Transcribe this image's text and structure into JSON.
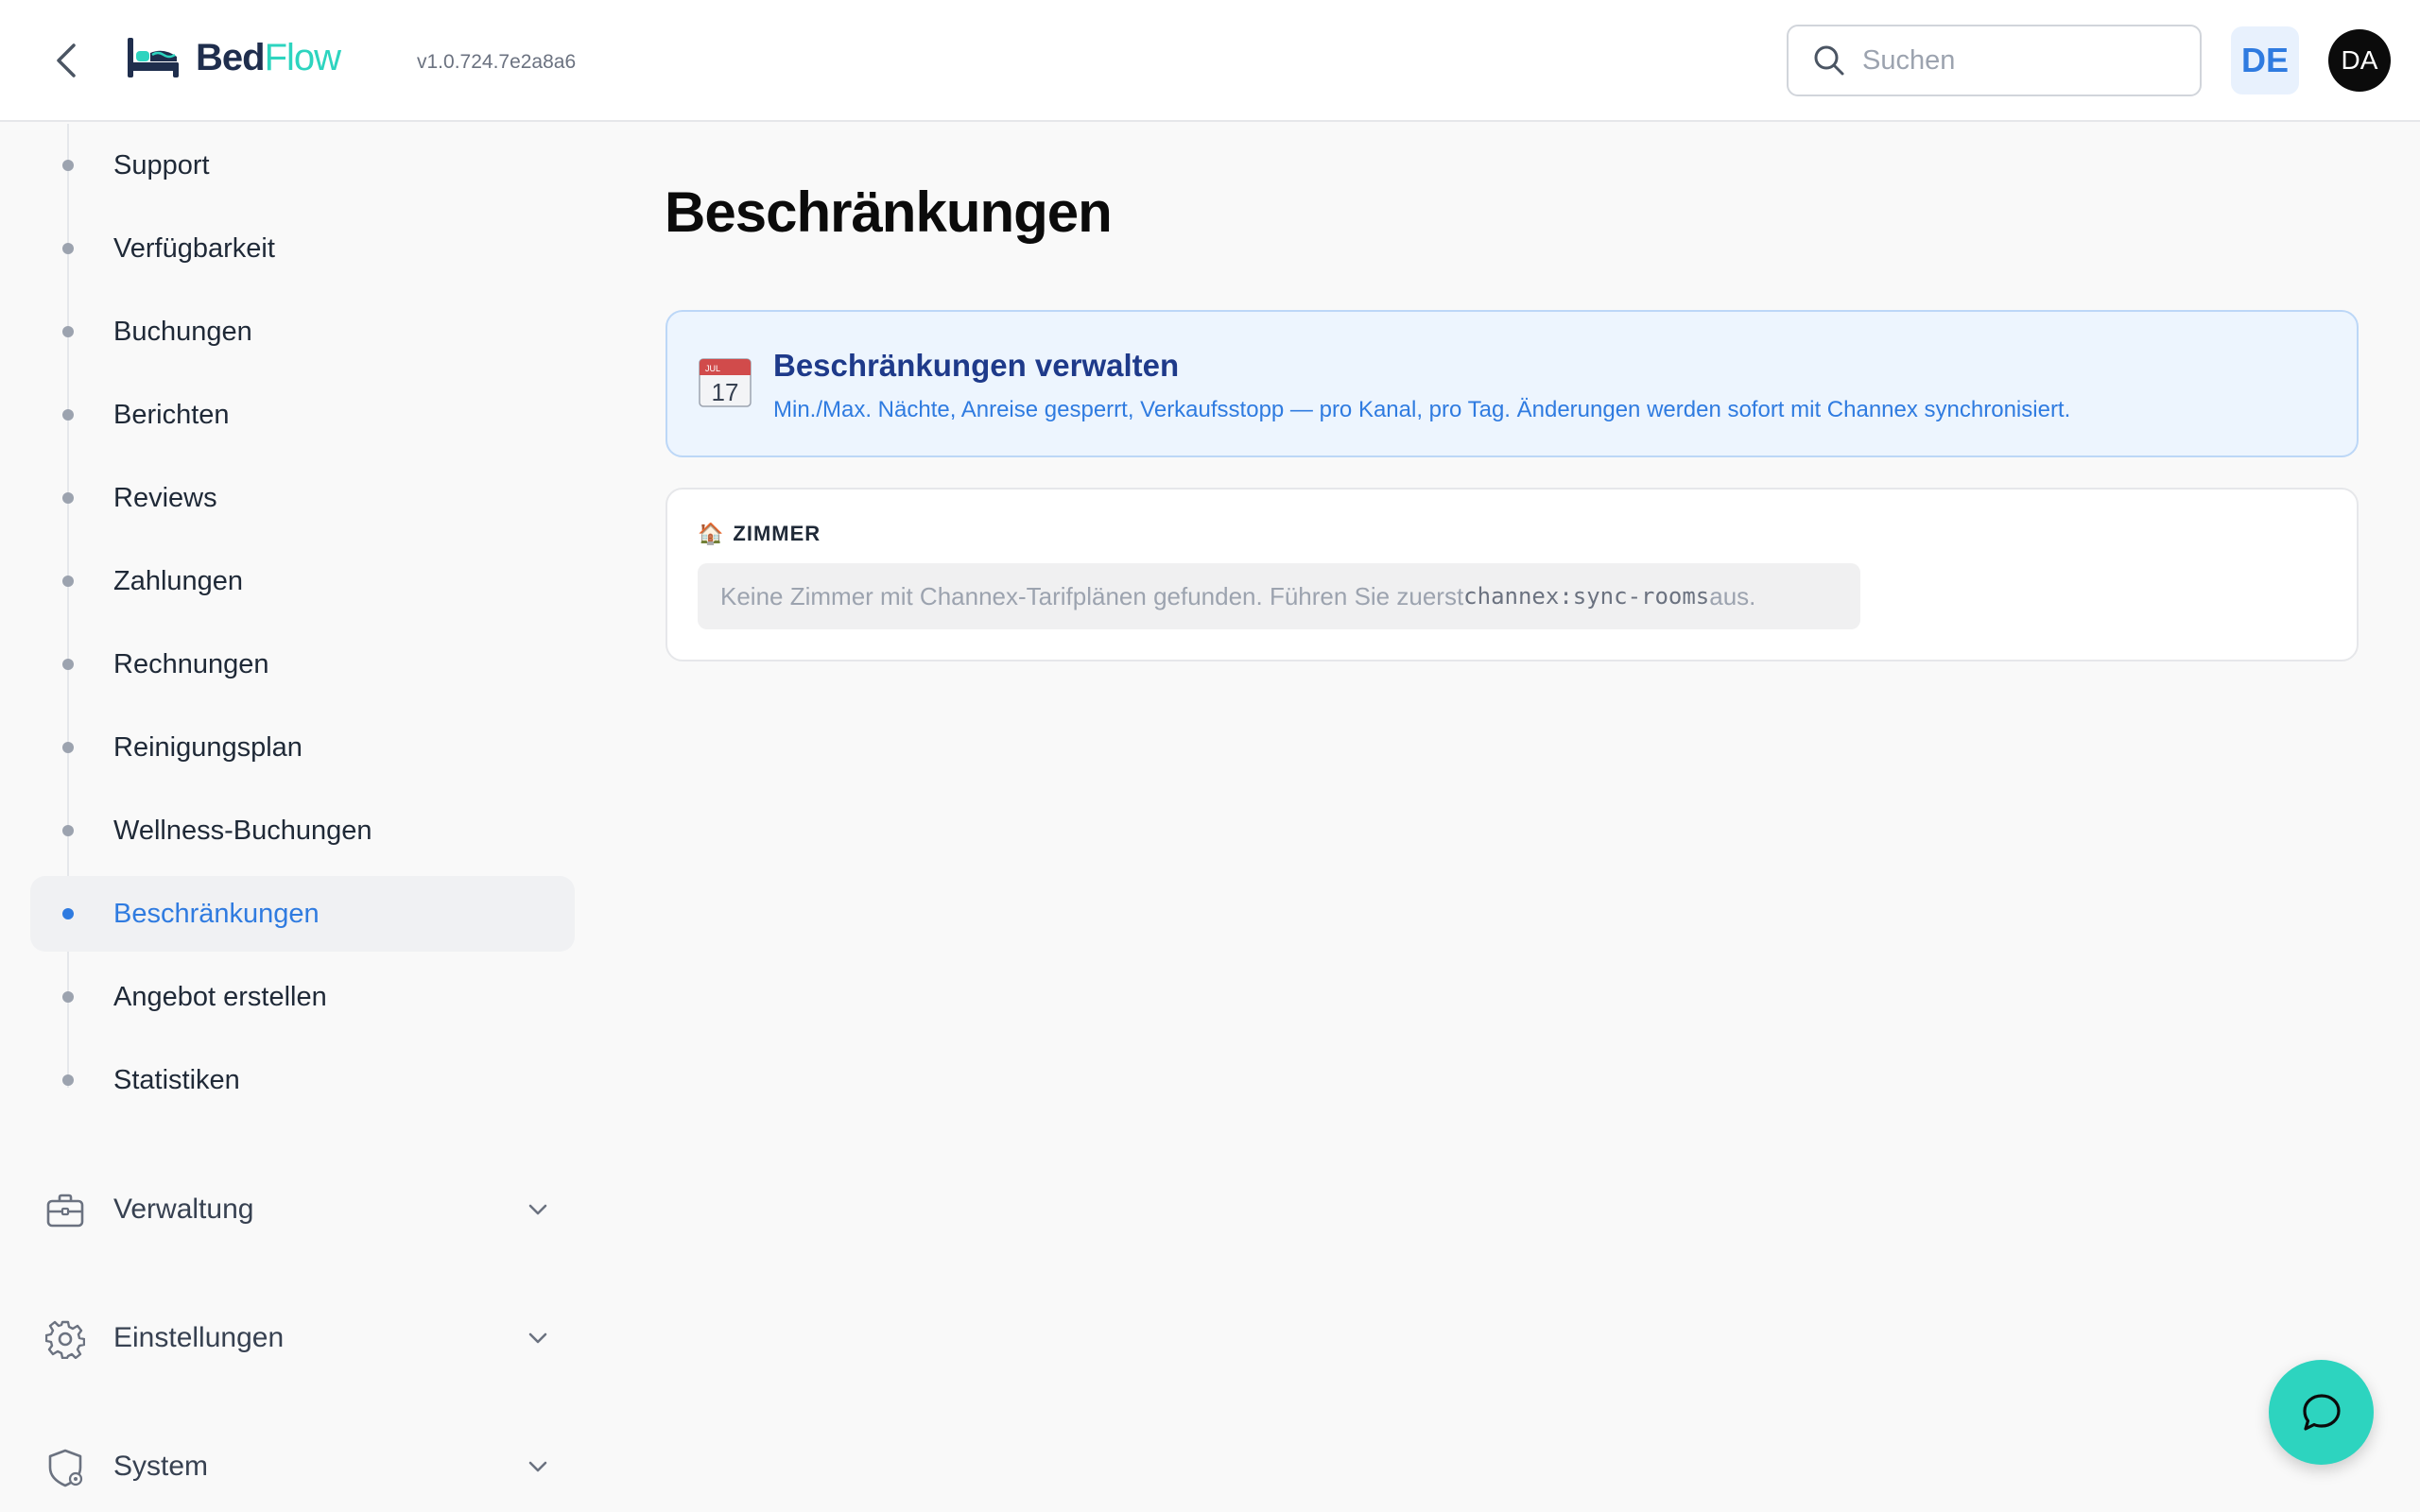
{
  "header": {
    "back_label": "Zurück",
    "logo_bed": "Bed",
    "logo_flow": "Flow",
    "version": "v1.0.724.7e2a8a6",
    "search_placeholder": "Suchen",
    "language": "DE",
    "avatar_initials": "DA"
  },
  "sidebar": {
    "items": [
      {
        "label": "Support",
        "active": false
      },
      {
        "label": "Verfügbarkeit",
        "active": false
      },
      {
        "label": "Buchungen",
        "active": false
      },
      {
        "label": "Berichten",
        "active": false
      },
      {
        "label": "Reviews",
        "active": false
      },
      {
        "label": "Zahlungen",
        "active": false
      },
      {
        "label": "Rechnungen",
        "active": false
      },
      {
        "label": "Reinigungsplan",
        "active": false
      },
      {
        "label": "Wellness-Buchungen",
        "active": false
      },
      {
        "label": "Beschränkungen",
        "active": true
      },
      {
        "label": "Angebot erstellen",
        "active": false
      },
      {
        "label": "Statistiken",
        "active": false
      }
    ],
    "groups": [
      {
        "label": "Verwaltung",
        "icon": "briefcase-icon"
      },
      {
        "label": "Einstellungen",
        "icon": "gear-icon"
      },
      {
        "label": "System",
        "icon": "shield-gear-icon"
      }
    ]
  },
  "main": {
    "title": "Beschränkungen",
    "info": {
      "icon": "calendar-icon",
      "title": "Beschränkungen verwalten",
      "text": "Min./Max. Nächte, Anreise gesperrt, Verkaufsstopp — pro Kanal, pro Tag. Änderungen werden sofort mit Channex synchronisiert."
    },
    "rooms": {
      "icon": "house-icon",
      "title": "ZIMMER",
      "empty_prefix": "Keine Zimmer mit Channex-Tarifplänen gefunden. Führen Sie zuerst ",
      "empty_code": "channex:sync-rooms",
      "empty_suffix": " aus."
    }
  },
  "colors": {
    "accent": "#2f7be0",
    "brand_teal": "#2dd4bf",
    "brand_navy": "#1f2e4d",
    "info_bg": "#edf5fe",
    "info_title": "#1e3a8a"
  }
}
